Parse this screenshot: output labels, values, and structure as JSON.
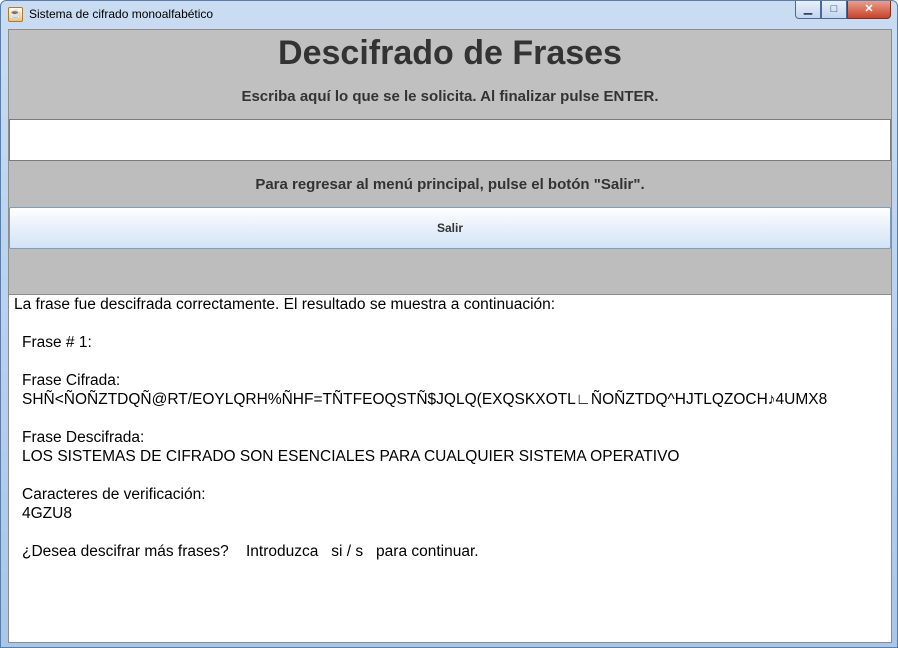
{
  "window": {
    "title": "Sistema de cifrado monoalfabético",
    "controls": {
      "minimize": "▁",
      "maximize": "□",
      "close": "✕"
    }
  },
  "header": {
    "heading": "Descifrado de Frases",
    "instruction": "Escriba aquí lo que se le solicita. Al finalizar pulse ENTER."
  },
  "input": {
    "value": ""
  },
  "return_text": "Para regresar al menú principal, pulse el botón \"Salir\".",
  "salir_label": "Salir",
  "output": {
    "status": "La frase fue descifrada correctamente. El resultado se muestra a continuación:",
    "frase_num": "Frase # 1:",
    "cifrada_label": "Frase Cifrada:",
    "cifrada_value": "SHÑ<ÑOÑZTDQÑ@RT/EOYLQRH%ÑHF=TÑTFEOQSTÑ$JQLQ(EXQSKXOTL∟ÑOÑZTDQ^HJTLQZOCH♪4UMX8",
    "descifrada_label": "Frase Descifrada:",
    "descifrada_value": "LOS SISTEMAS DE CIFRADO SON ESENCIALES PARA CUALQUIER SISTEMA OPERATIVO",
    "verif_label": "Caracteres de verificación:",
    "verif_value": "4GZU8",
    "prompt": "¿Desea descifrar más frases?    Introduzca   si / s   para continuar."
  }
}
